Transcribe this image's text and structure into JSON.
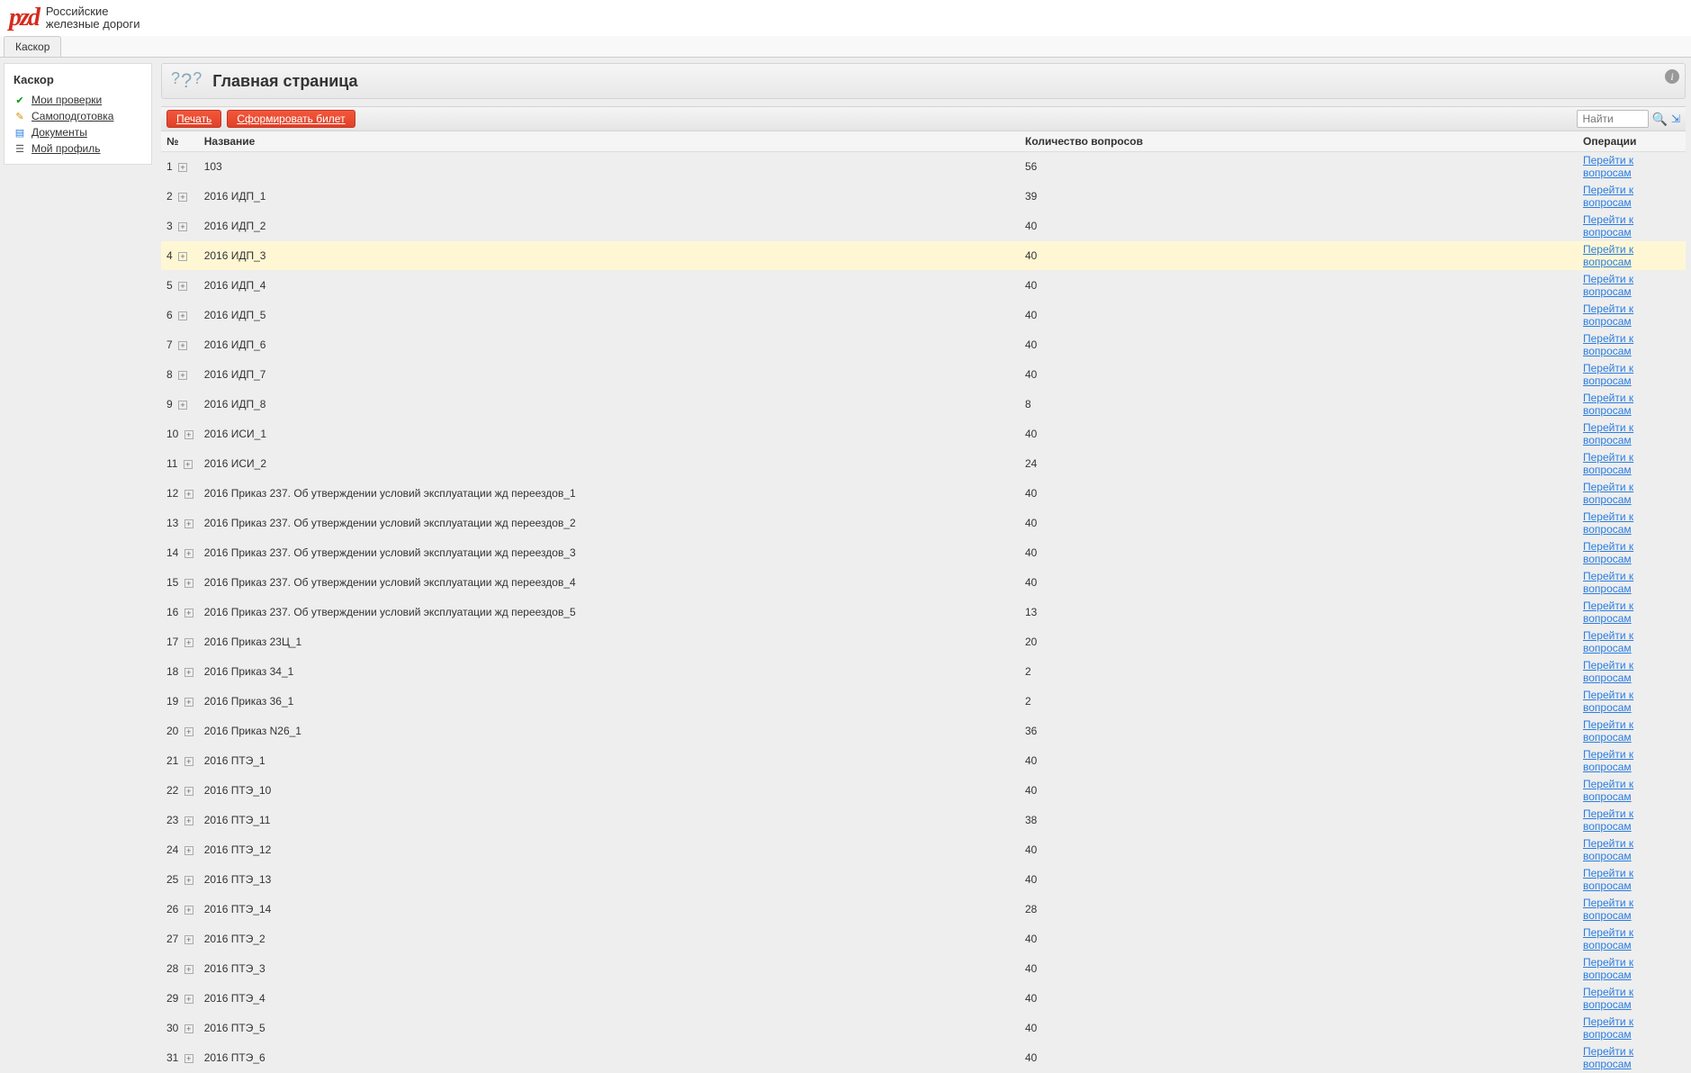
{
  "header": {
    "org_line1": "Российские",
    "org_line2": "железные дороги",
    "tab": "Каскор"
  },
  "sidebar": {
    "title": "Каскор",
    "items": [
      {
        "label": "Мои проверки",
        "icon": "check"
      },
      {
        "label": "Самоподготовка",
        "icon": "self"
      },
      {
        "label": "Документы",
        "icon": "doc"
      },
      {
        "label": "Мой профиль",
        "icon": "profile"
      }
    ]
  },
  "page": {
    "title": "Главная страница",
    "buttons": {
      "print": "Печать",
      "form": "Сформировать билет"
    },
    "search_placeholder": "Найти"
  },
  "table": {
    "columns": {
      "num": "№",
      "name": "Название",
      "count": "Количество вопросов",
      "ops": "Операции"
    },
    "op_link": "Перейти к вопросам",
    "highlight_row": 4,
    "rows": [
      {
        "n": 1,
        "name": "103",
        "count": 56
      },
      {
        "n": 2,
        "name": "2016 ИДП_1",
        "count": 39
      },
      {
        "n": 3,
        "name": "2016 ИДП_2",
        "count": 40
      },
      {
        "n": 4,
        "name": "2016 ИДП_3",
        "count": 40
      },
      {
        "n": 5,
        "name": "2016 ИДП_4",
        "count": 40
      },
      {
        "n": 6,
        "name": "2016 ИДП_5",
        "count": 40
      },
      {
        "n": 7,
        "name": "2016 ИДП_6",
        "count": 40
      },
      {
        "n": 8,
        "name": "2016 ИДП_7",
        "count": 40
      },
      {
        "n": 9,
        "name": "2016 ИДП_8",
        "count": 8
      },
      {
        "n": 10,
        "name": "2016 ИСИ_1",
        "count": 40
      },
      {
        "n": 11,
        "name": "2016 ИСИ_2",
        "count": 24
      },
      {
        "n": 12,
        "name": "2016 Приказ 237. Об утверждении условий эксплуатации жд переездов_1",
        "count": 40
      },
      {
        "n": 13,
        "name": "2016 Приказ 237. Об утверждении условий эксплуатации жд переездов_2",
        "count": 40
      },
      {
        "n": 14,
        "name": "2016 Приказ 237. Об утверждении условий эксплуатации жд переездов_3",
        "count": 40
      },
      {
        "n": 15,
        "name": "2016 Приказ 237. Об утверждении условий эксплуатации жд переездов_4",
        "count": 40
      },
      {
        "n": 16,
        "name": "2016 Приказ 237. Об утверждении условий эксплуатации жд переездов_5",
        "count": 13
      },
      {
        "n": 17,
        "name": "2016 Приказ 23Ц_1",
        "count": 20
      },
      {
        "n": 18,
        "name": "2016 Приказ 34_1",
        "count": 2
      },
      {
        "n": 19,
        "name": "2016 Приказ 36_1",
        "count": 2
      },
      {
        "n": 20,
        "name": "2016 Приказ N26_1",
        "count": 36
      },
      {
        "n": 21,
        "name": "2016 ПТЭ_1",
        "count": 40
      },
      {
        "n": 22,
        "name": "2016 ПТЭ_10",
        "count": 40
      },
      {
        "n": 23,
        "name": "2016 ПТЭ_11",
        "count": 38
      },
      {
        "n": 24,
        "name": "2016 ПТЭ_12",
        "count": 40
      },
      {
        "n": 25,
        "name": "2016 ПТЭ_13",
        "count": 40
      },
      {
        "n": 26,
        "name": "2016 ПТЭ_14",
        "count": 28
      },
      {
        "n": 27,
        "name": "2016 ПТЭ_2",
        "count": 40
      },
      {
        "n": 28,
        "name": "2016 ПТЭ_3",
        "count": 40
      },
      {
        "n": 29,
        "name": "2016 ПТЭ_4",
        "count": 40
      },
      {
        "n": 30,
        "name": "2016 ПТЭ_5",
        "count": 40
      },
      {
        "n": 31,
        "name": "2016 ПТЭ_6",
        "count": 40
      }
    ]
  }
}
